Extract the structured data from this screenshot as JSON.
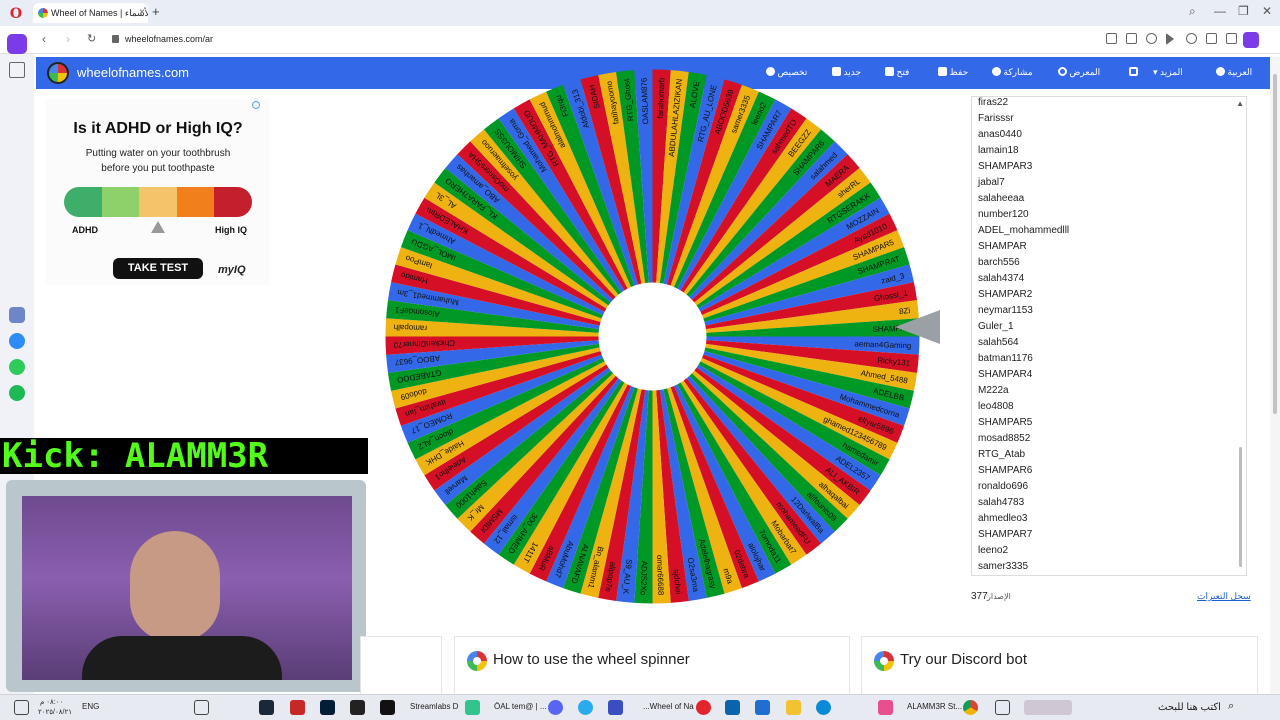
{
  "browser": {
    "tab_title": "Wheel of Names | دولاب الأسماء",
    "url": "wheelofnames.com/ar",
    "accent": "#7a3ce8"
  },
  "header": {
    "brand": "wheelofnames.com",
    "color": "#3369e8",
    "menu": {
      "customize": "تخصيص",
      "new": "جديد",
      "open": "فتح",
      "save": "حفظ",
      "share": "مشاركة",
      "gallery": "المعرض",
      "more": "المزيد",
      "language": "العربية"
    }
  },
  "ad": {
    "title": "Is it ADHD or High IQ?",
    "subtitle_line1": "Putting water on your toothbrush",
    "subtitle_line2": "before you put toothpaste",
    "label_left": "ADHD",
    "label_right": "High IQ",
    "button": "TAKE TEST",
    "brand": "myIQ",
    "bar_colors": [
      "#3fae6a",
      "#8ed06a",
      "#f4c46a",
      "#f07f1c",
      "#c31f2c"
    ]
  },
  "stream": {
    "kick_label": "Kick: ALAMM3R"
  },
  "wheel": {
    "colors": [
      "#3369e8",
      "#d50f25",
      "#eeb211",
      "#009925"
    ],
    "visible_names": [
      "aeman4Gaming",
      "Ricky131",
      "Ahmed_5488",
      "ADELBB",
      "Mohammedcorna",
      "eltyar5896",
      "ghamed123456789",
      "hamedamir",
      "ADEL2357",
      "ALI_AKBIR",
      "alhaqalbai",
      "alifounis09",
      "12DarlwalBa",
      "mohameedFU",
      "Mobarbat7",
      "7omoda11",
      "alolojhar",
      "02dabra",
      "m9a",
      "Adelelhagrasy",
      "O2sa3ma",
      "sjdchei",
      "omar66688",
      "ADJS2Xo",
      "S9_AU_K",
      "alipop7e",
      "Bn_alamm1",
      "ALNAVAFD",
      "AbuMohd7",
      "aBMuR",
      "1411T",
      "300_AHMED",
      "ismail_12",
      "MSMIDI",
      "Mr_K",
      "Saleh1000",
      "Marvell",
      "Adelelho1",
      "Haide_DHK",
      "dioon_AL2",
      "ROMEO_17",
      "Ibrahim_fan",
      "dodo09",
      "GTABEDOO",
      "ABOO_9637",
      "ChickenDinner70",
      "ramopalh",
      "AlosomdeF1",
      "Muhammed1_3m",
      "Hamido",
      "IamPoo",
      "IMOL_AGDU",
      "AhmedN_1",
      "KHALEDRtm",
      "AL_3L",
      "KL_FARA7HERO",
      "ABO_amanhas",
      "moOsnorsSHA",
      "yosefmaeruoo",
      "SHIMOU3SS",
      "Mohamed_Goma",
      "RTG_MAHMOUD",
      "alalmohmmud",
      "Fi3rqu",
      "Afdobi_313",
      "SIDAH",
      "fatihayoomo",
      "RTG_Ghost",
      "OASLAM876",
      "farahomarb",
      "ABDULAHLAZIZIKAN",
      "ALOVE",
      "RTG_AU_LONE",
      "ABOOD5639",
      "samer3335",
      "leeno2",
      "SHAMPAR7",
      "sahmedTO",
      "BEEGZZ",
      "SHAMPAR6",
      "salahmed",
      "MAERA",
      "sherRL",
      "RTGSERAKK",
      "MOZZAIN",
      "Ayad1010",
      "SHAMPAR5",
      "SHAMPRAT",
      "zaid_3",
      "Ghosst_1",
      "8Zi",
      "SHAMPAR"
    ]
  },
  "entries": {
    "items": [
      "firas22",
      "Farisssr",
      "anas0440",
      "lamain18",
      "SHAMPAR3",
      "jabal7",
      "salaheeaa",
      "number120",
      "ADEL_mohammedlll",
      "SHAMPAR",
      "barch556",
      "salah4374",
      "SHAMPAR2",
      "neymar1153",
      "Guler_1",
      "salah564",
      "batman1176",
      "SHAMPAR4",
      "M222a",
      "leo4808",
      "SHAMPAR5",
      "mosad8852",
      "RTG_Atab",
      "SHAMPAR6",
      "ronaldo696",
      "salah4783",
      "ahmedleo3",
      "SHAMPAR7",
      "leeno2",
      "samer3335"
    ],
    "count": "377",
    "count_label": "الإصدار",
    "results_link": "سجل التعيرات"
  },
  "cards": {
    "how_to": "How to use the wheel spinner",
    "discord": "Try our Discord bot"
  },
  "taskbar": {
    "search_placeholder": "اكتب هنا للبحث",
    "time": "٠٨:٠٠ م",
    "date": "٢٠٢٥/٠٨/٢١",
    "lang": "ENG",
    "task_streamlabs": "Streamlabs D",
    "task_discord": "ÖAL tem@ | ...",
    "task_wheel": "...Wheel of Na",
    "task_chrome": "ALAMM3R St..."
  }
}
